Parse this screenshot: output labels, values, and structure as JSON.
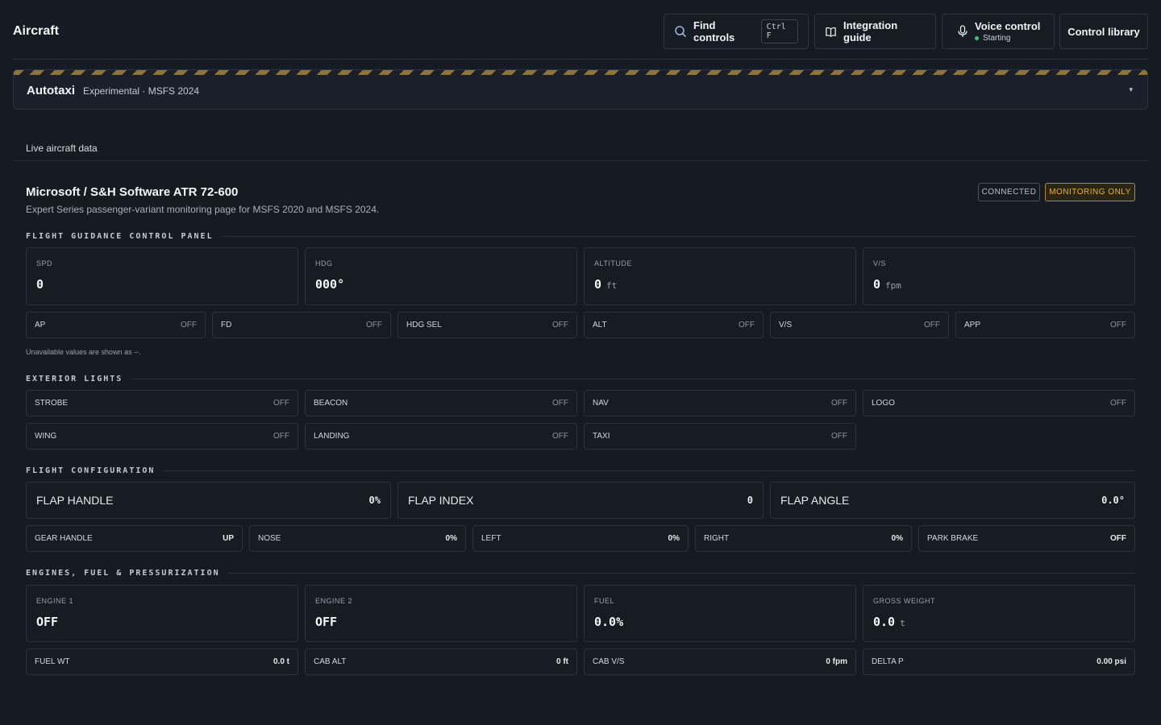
{
  "header": {
    "title": "Aircraft",
    "find": {
      "label": "Find controls",
      "shortcut": "Ctrl F",
      "icon": "search-icon"
    },
    "guide": {
      "label": "Integration guide",
      "icon": "book-icon"
    },
    "voice": {
      "label": "Voice control",
      "status": "Starting",
      "status_color": "#2ecc71",
      "icon": "microphone-icon"
    },
    "library": {
      "label": "Control library"
    }
  },
  "autotaxi": {
    "title": "Autotaxi",
    "subtitle": "Experimental · MSFS 2024",
    "expand_icon": "▾"
  },
  "tab": {
    "label": "Live aircraft data"
  },
  "aircraft": {
    "title": "Microsoft / S&H Software ATR 72-600",
    "subtitle": "Expert Series passenger-variant monitoring page for MSFS 2020 and MSFS 2024.",
    "badges": {
      "connected": "CONNECTED",
      "monitoring": "MONITORING ONLY"
    },
    "colors": {
      "accent": "#e8b339",
      "bg": "#161b23",
      "card": "#171c24"
    }
  },
  "fgcp": {
    "title": "FLIGHT GUIDANCE CONTROL PANEL",
    "cards": [
      {
        "label": "SPD",
        "value": "0",
        "unit": ""
      },
      {
        "label": "HDG",
        "value": "000°",
        "unit": ""
      },
      {
        "label": "ALTITUDE",
        "value": "0",
        "unit": "ft"
      },
      {
        "label": "V/S",
        "value": "0",
        "unit": "fpm"
      }
    ],
    "modes": [
      {
        "label": "AP",
        "state": "OFF"
      },
      {
        "label": "FD",
        "state": "OFF"
      },
      {
        "label": "HDG SEL",
        "state": "OFF"
      },
      {
        "label": "ALT",
        "state": "OFF"
      },
      {
        "label": "V/S",
        "state": "OFF"
      },
      {
        "label": "APP",
        "state": "OFF"
      }
    ],
    "note": "Unavailable values are shown as --."
  },
  "lights": {
    "title": "EXTERIOR LIGHTS",
    "items": [
      {
        "label": "STROBE",
        "state": "OFF"
      },
      {
        "label": "BEACON",
        "state": "OFF"
      },
      {
        "label": "NAV",
        "state": "OFF"
      },
      {
        "label": "LOGO",
        "state": "OFF"
      },
      {
        "label": "WING",
        "state": "OFF"
      },
      {
        "label": "LANDING",
        "state": "OFF"
      },
      {
        "label": "TAXI",
        "state": "OFF"
      }
    ]
  },
  "config": {
    "title": "FLIGHT CONFIGURATION",
    "flaps": [
      {
        "label": "FLAP HANDLE",
        "value": "0%"
      },
      {
        "label": "FLAP INDEX",
        "value": "0"
      },
      {
        "label": "FLAP ANGLE",
        "value": "0.0°"
      }
    ],
    "gear": [
      {
        "label": "GEAR HANDLE",
        "value": "UP"
      },
      {
        "label": "NOSE",
        "value": "0%"
      },
      {
        "label": "LEFT",
        "value": "0%"
      },
      {
        "label": "RIGHT",
        "value": "0%"
      },
      {
        "label": "PARK BRAKE",
        "value": "OFF"
      }
    ]
  },
  "engines": {
    "title": "ENGINES, FUEL & PRESSURIZATION",
    "cards": [
      {
        "label": "ENGINE 1",
        "value": "OFF",
        "unit": ""
      },
      {
        "label": "ENGINE 2",
        "value": "OFF",
        "unit": ""
      },
      {
        "label": "FUEL",
        "value": "0.0%",
        "unit": ""
      },
      {
        "label": "GROSS WEIGHT",
        "value": "0.0",
        "unit": "t"
      }
    ],
    "readouts": [
      {
        "label": "FUEL WT",
        "value": "0.0 t"
      },
      {
        "label": "CAB ALT",
        "value": "0 ft"
      },
      {
        "label": "CAB V/S",
        "value": "0 fpm"
      },
      {
        "label": "DELTA P",
        "value": "0.00 psi"
      }
    ]
  }
}
